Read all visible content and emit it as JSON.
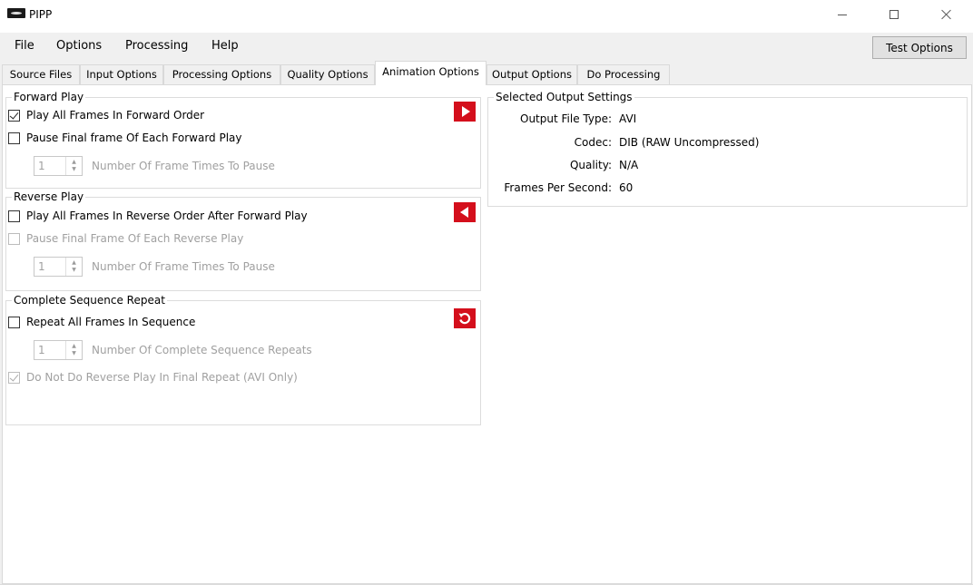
{
  "window": {
    "title": "PIPP"
  },
  "menu": {
    "items": [
      "File",
      "Options",
      "Processing",
      "Help"
    ],
    "test_button": "Test Options"
  },
  "tabs": [
    "Source Files",
    "Input Options",
    "Processing Options",
    "Quality Options",
    "Animation Options",
    "Output Options",
    "Do Processing"
  ],
  "active_tab": "Animation Options",
  "forward_play": {
    "title": "Forward Play",
    "play_all": {
      "label": "Play All Frames In Forward Order",
      "checked": true
    },
    "pause_final": {
      "label": "Pause Final frame Of Each Forward Play",
      "checked": false
    },
    "pause_count": {
      "value": "1",
      "label": "Number Of Frame Times To Pause"
    },
    "icon": "play-forward-icon"
  },
  "reverse_play": {
    "title": "Reverse Play",
    "play_all": {
      "label": "Play All Frames In Reverse Order After Forward Play",
      "checked": false
    },
    "pause_final": {
      "label": "Pause Final Frame Of Each Reverse Play",
      "checked": false
    },
    "pause_count": {
      "value": "1",
      "label": "Number Of Frame Times To Pause"
    },
    "icon": "play-reverse-icon"
  },
  "sequence_repeat": {
    "title": "Complete Sequence Repeat",
    "repeat_all": {
      "label": "Repeat All Frames In Sequence",
      "checked": false
    },
    "repeat_count": {
      "value": "1",
      "label": "Number Of Complete Sequence Repeats"
    },
    "no_reverse_final": {
      "label": "Do Not Do Reverse Play In Final Repeat (AVI Only)",
      "checked": true
    },
    "icon": "repeat-icon"
  },
  "output_settings": {
    "title": "Selected Output Settings",
    "rows": [
      {
        "label": "Output File Type:",
        "value": "AVI"
      },
      {
        "label": "Codec:",
        "value": "DIB (RAW Uncompressed)"
      },
      {
        "label": "Quality:",
        "value": "N/A"
      },
      {
        "label": "Frames Per Second:",
        "value": "60"
      }
    ]
  },
  "colors": {
    "accent_red": "#d40f1c",
    "disabled_text": "#a0a0a0"
  }
}
